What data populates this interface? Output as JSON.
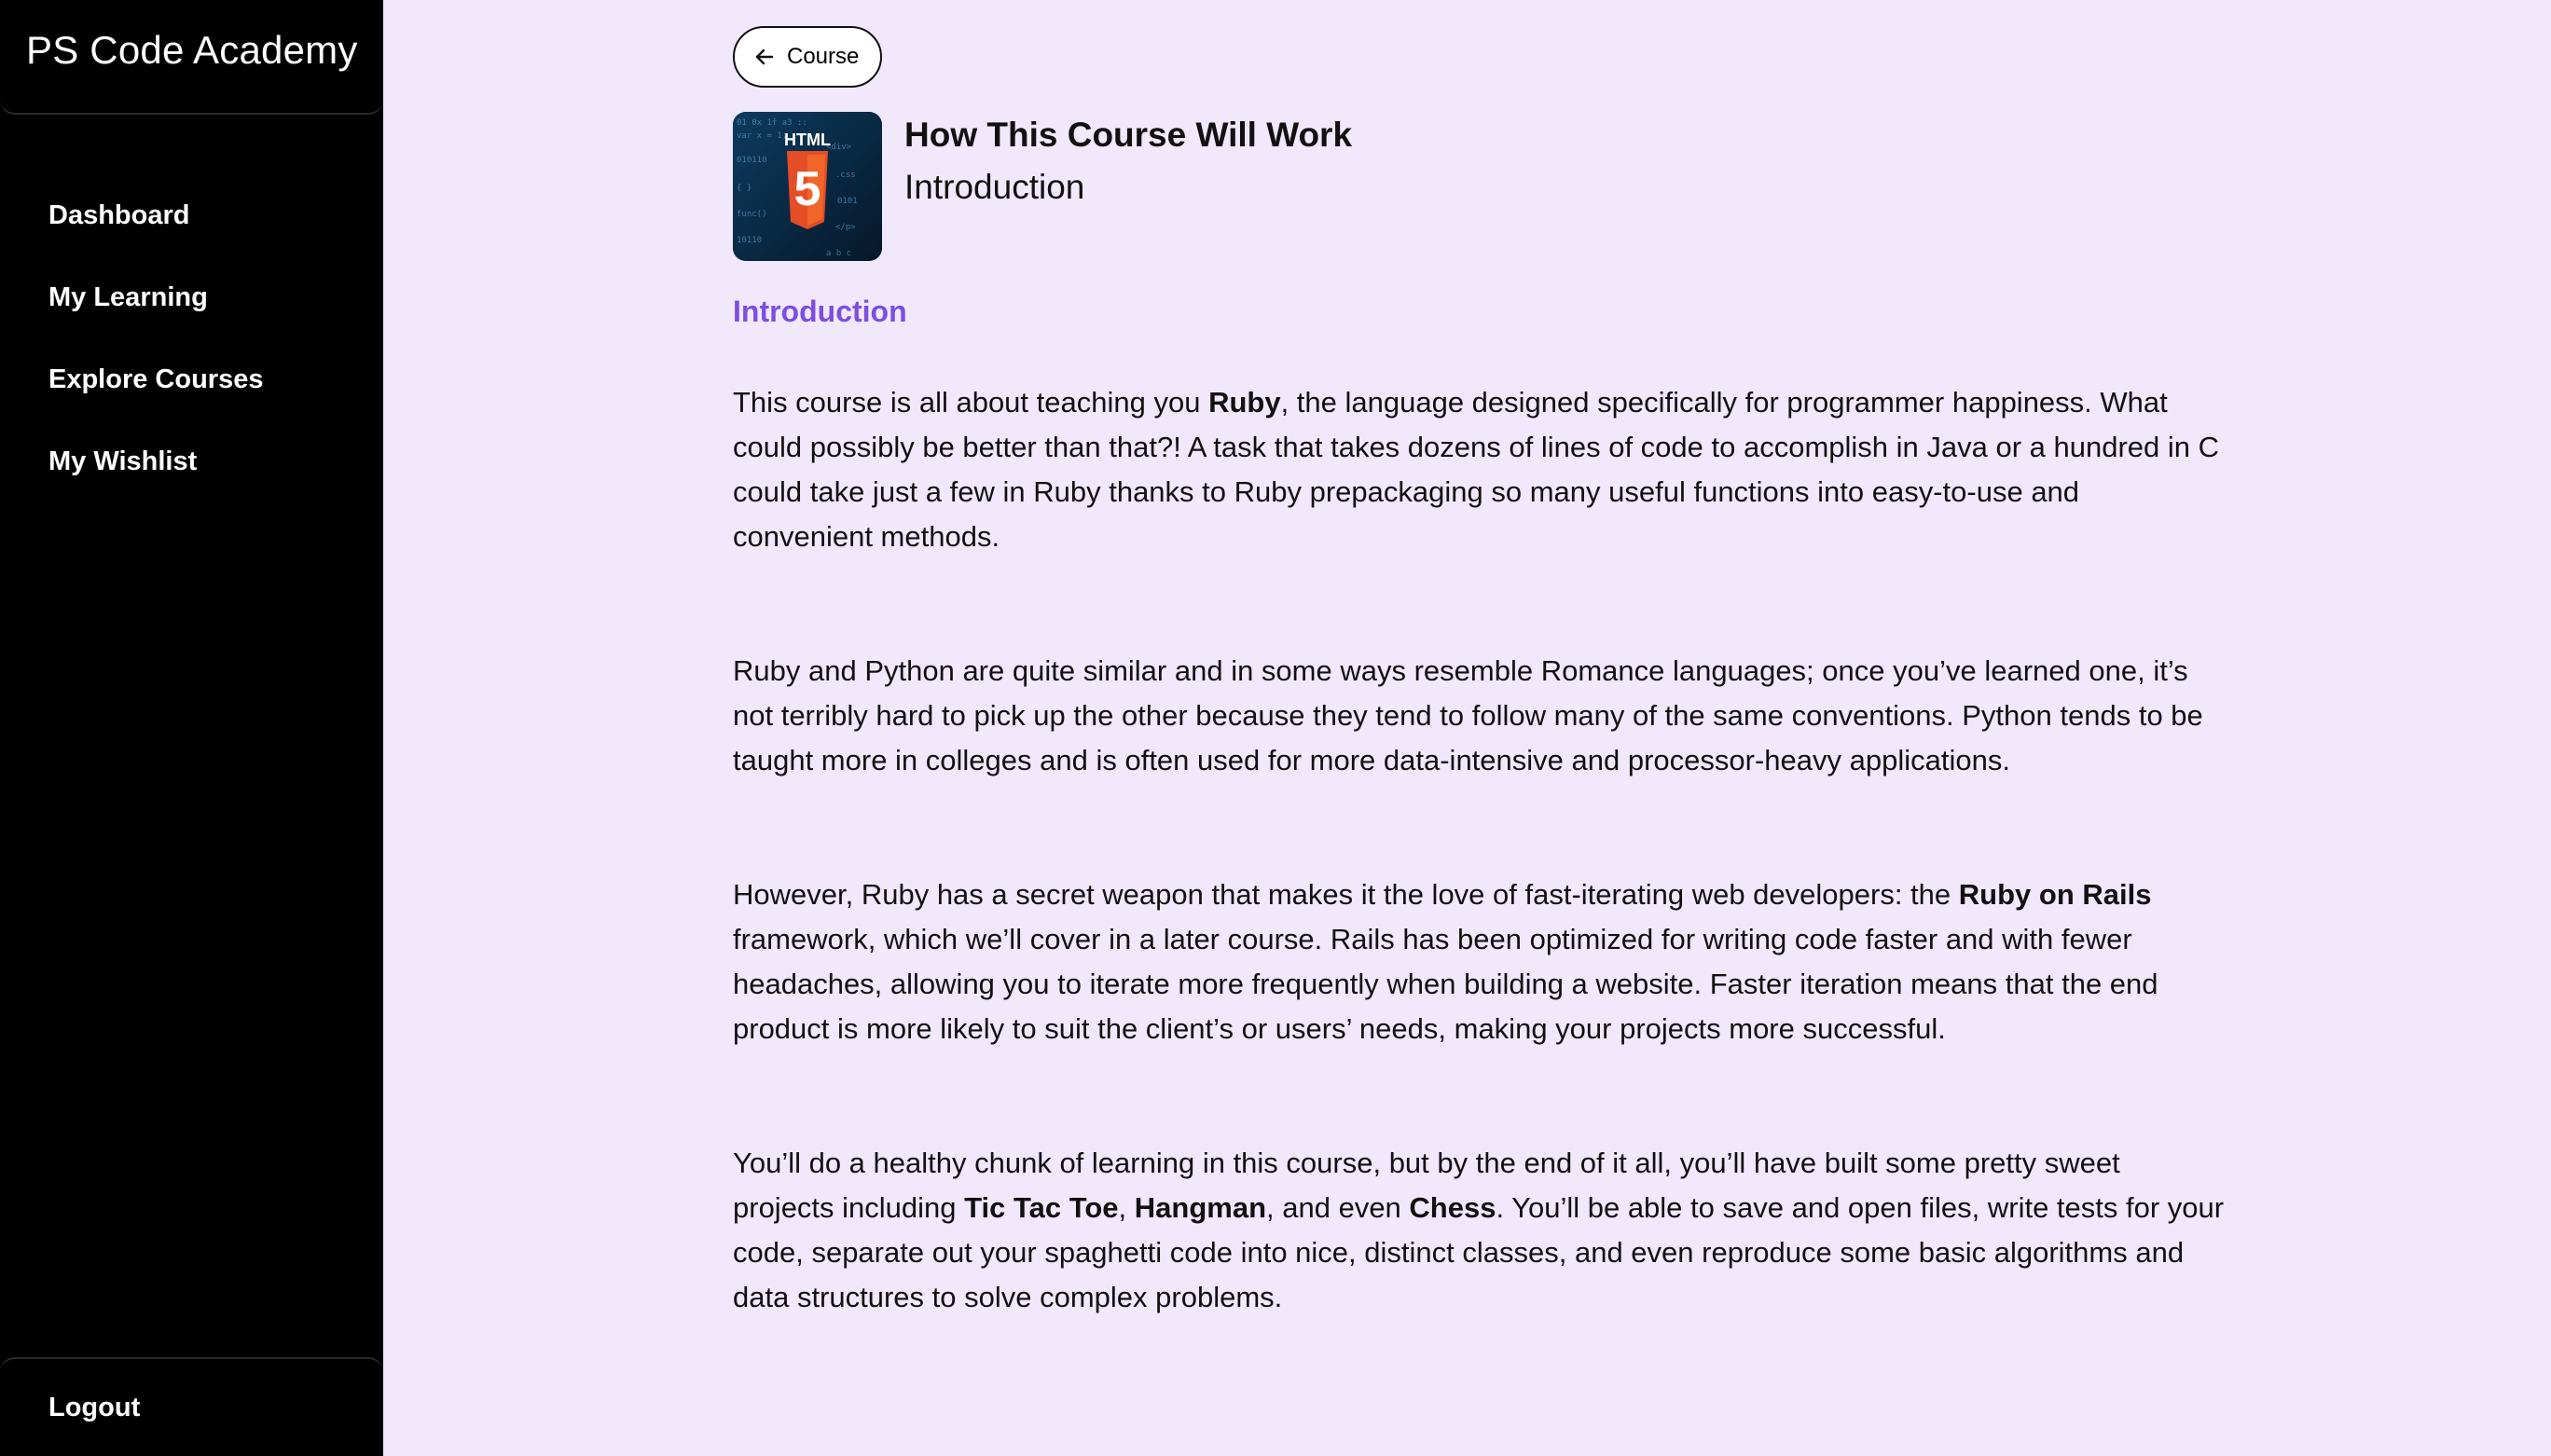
{
  "brand": "PS Code Academy",
  "nav": [
    {
      "label": "Dashboard"
    },
    {
      "label": "My Learning"
    },
    {
      "label": "Explore Courses"
    },
    {
      "label": "My Wishlist"
    }
  ],
  "logout_label": "Logout",
  "back_button": {
    "label": "Course"
  },
  "lesson": {
    "title": "How This Course Will Work",
    "subtitle": "Introduction",
    "section_heading": "Introduction",
    "thumbnail_text": "HTML",
    "thumbnail_badge": "5"
  },
  "paragraphs": {
    "p1": {
      "a": "This course is all about teaching you ",
      "b1": "Ruby",
      "c": ", the language designed specifically for programmer happiness. What could possibly be better than that?! A task that takes dozens of lines of code to accomplish in Java or a hundred in C could take just a few in Ruby thanks to Ruby prepackaging so many useful functions into easy-to-use and convenient methods."
    },
    "p2": "Ruby and Python are quite similar and in some ways resemble Romance languages; once you’ve learned one, it’s not terribly hard to pick up the other because they tend to follow many of the same conventions. Python tends to be taught more in colleges and is often used for more data-intensive and processor-heavy applications.",
    "p3": {
      "a": "However, Ruby has a secret weapon that makes it the love of fast-iterating web developers: the ",
      "b1": "Ruby on Rails",
      "c": " framework, which we’ll cover in a later course. Rails has been optimized for writing code faster and with fewer headaches, allowing you to iterate more frequently when building a website. Faster iteration means that the end product is more likely to suit the client’s or users’ needs, making your projects more successful."
    },
    "p4": {
      "a": "You’ll do a healthy chunk of learning in this course, but by the end of it all, you’ll have built some pretty sweet projects including ",
      "b1": "Tic Tac Toe",
      "sep1": ", ",
      "b2": "Hangman",
      "sep2": ", and even ",
      "b3": "Chess",
      "c": ". You’ll be able to save and open files, write tests for your code, separate out your spaghetti code into nice, distinct classes, and even reproduce some basic algorithms and data structures to solve complex problems."
    }
  },
  "colors": {
    "background": "#f1e8fc",
    "sidebar": "#000000",
    "accent": "#7c4fe0"
  },
  "icons": {
    "back": "arrow-left-icon"
  }
}
